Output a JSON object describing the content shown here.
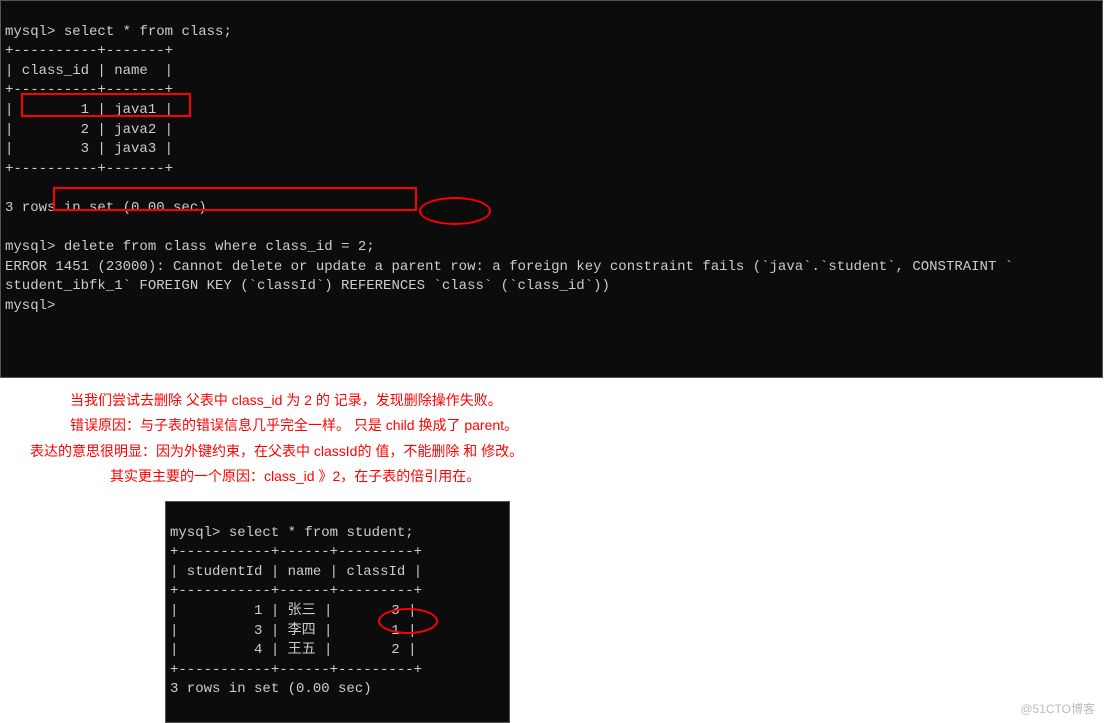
{
  "terminal1": {
    "line1_prompt": "mysql>",
    "line1_cmd": " select * from class;",
    "sep_top": "+----------+-------+",
    "header_class_id": " class_id ",
    "header_name": " name  ",
    "sep_mid": "+----------+-------+",
    "row1_id": "        1 ",
    "row1_name": " java1 ",
    "row2_id": "        2 ",
    "row2_name": " java2 ",
    "row3_id": "        3 ",
    "row3_name": " java3 ",
    "sep_bot": "+----------+-------+",
    "rows_msg": "3 rows in set (0.00 sec)",
    "line2_prompt": "mysql>",
    "line2_cmd": " delete from class where class_id = 2;",
    "err1": "ERROR 1451 (23000): Cannot delete or update a parent row: a foreign key constraint fails (`java`.`student`, CONSTRAINT `",
    "err2": "student_ibfk_1` FOREIGN KEY (`classId`) REFERENCES `class` (`class_id`))",
    "line3_prompt": "mysql>"
  },
  "notes": {
    "n1": "当我们尝试去删除 父表中 class_id 为 2 的 记录，发现删除操作失败。",
    "n2": "错误原因：与子表的错误信息几乎完全一样。 只是 child 换成了 parent。",
    "n3": "表达的意思很明显：因为外键约束，在父表中 classId的 值，不能删除 和 修改。",
    "n4": "其实更主要的一个原因：class_id 》2，在子表的倍引用在。"
  },
  "terminal2": {
    "line1_prompt": "mysql>",
    "line1_cmd": " select * from student;",
    "sep_top": "+-----------+------+---------+",
    "header_sid": " studentId ",
    "header_name": " name ",
    "header_cid": " classId ",
    "sep_mid": "+-----------+------+---------+",
    "row1_sid": "         1 ",
    "row1_name": " 张三 ",
    "row1_cid": "       3 ",
    "row2_sid": "         3 ",
    "row2_name": " 李四 ",
    "row2_cid": "       1 ",
    "row3_sid": "         4 ",
    "row3_name": " 王五 ",
    "row3_cid": "       2 ",
    "sep_bot": "+-----------+------+---------+",
    "rows_msg": "3 rows in set (0.00 sec)"
  },
  "watermark": "@51CTO博客"
}
